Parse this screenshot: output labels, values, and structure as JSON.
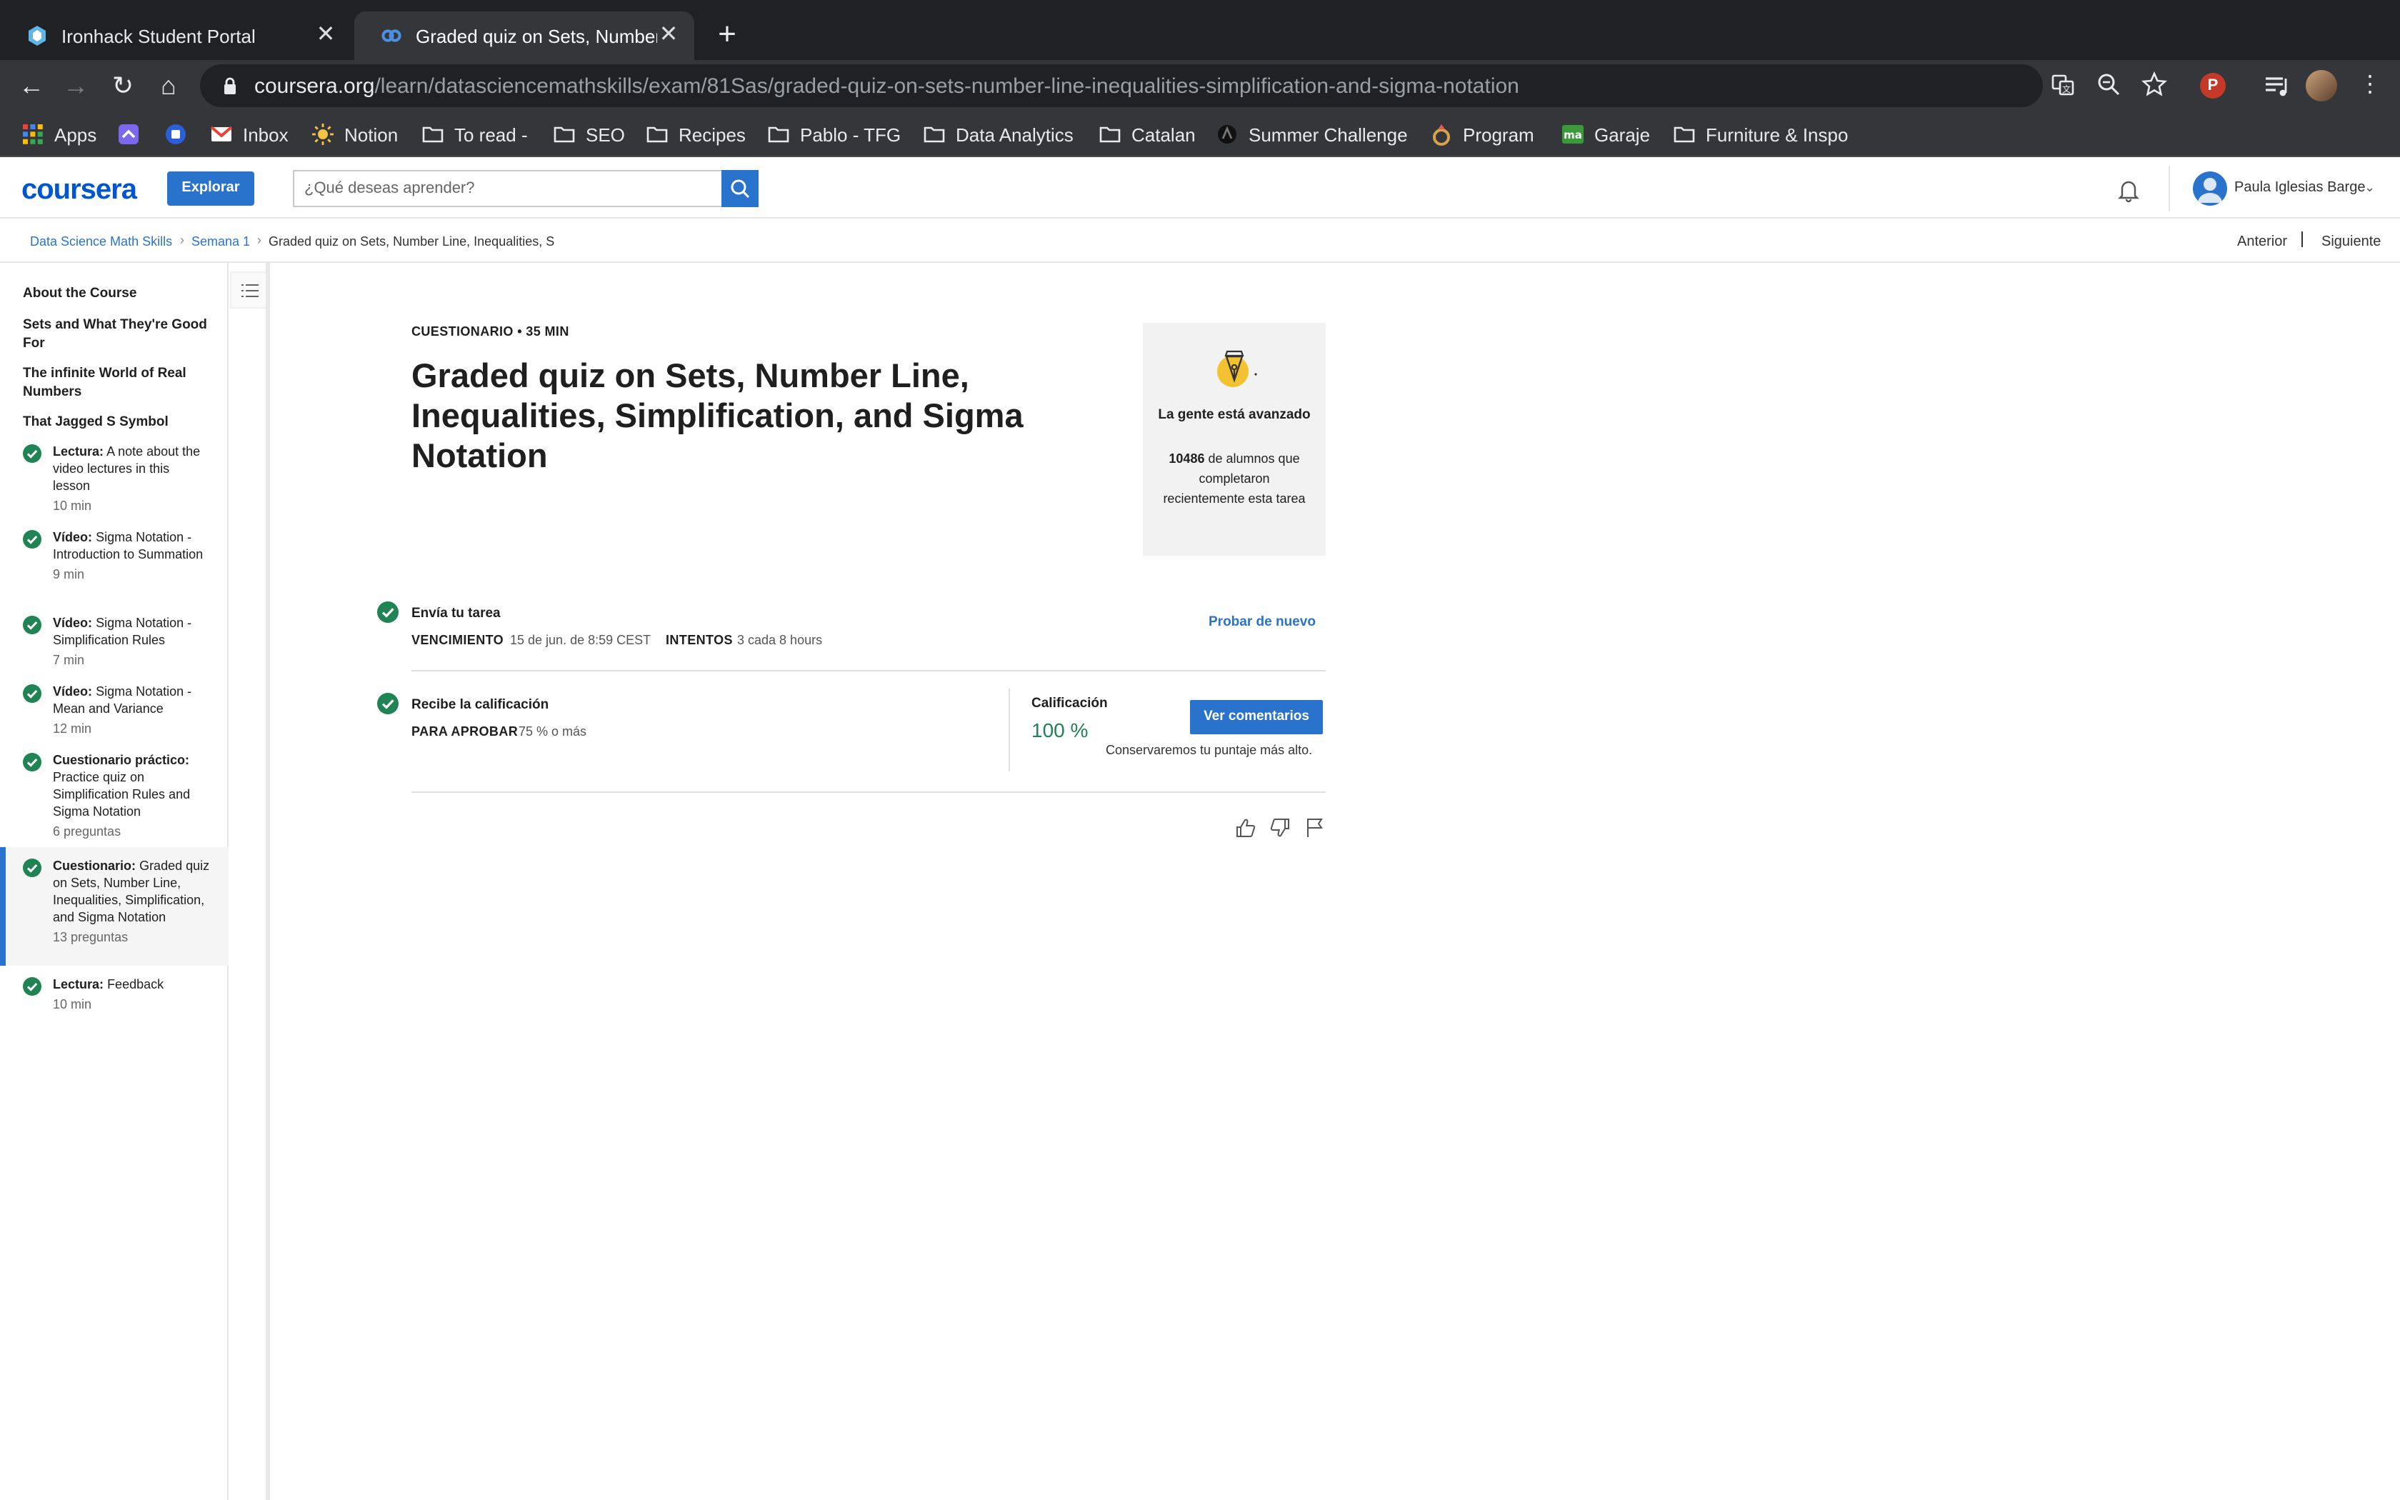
{
  "browser": {
    "tabs": [
      {
        "title": "Ironhack Student Portal",
        "active": false
      },
      {
        "title": "Graded quiz on Sets, Number L",
        "active": true
      }
    ],
    "url_host": "coursera.org",
    "url_path": "/learn/datasciencemathskills/exam/81Sas/graded-quiz-on-sets-number-line-inequalities-simplification-and-sigma-notation",
    "profile_badge": "P",
    "bookmarks": [
      {
        "label": "Apps",
        "icon": "apps-grid-icon"
      },
      {
        "label": "",
        "icon": "clickup-icon"
      },
      {
        "label": "",
        "icon": "blue-app-icon"
      },
      {
        "label": "Inbox",
        "icon": "gmail-icon"
      },
      {
        "label": "Notion",
        "icon": "sun-icon"
      },
      {
        "label": "To read -",
        "icon": "folder-icon"
      },
      {
        "label": "SEO",
        "icon": "folder-icon"
      },
      {
        "label": "Recipes",
        "icon": "folder-icon"
      },
      {
        "label": "Pablo - TFG",
        "icon": "folder-icon"
      },
      {
        "label": "Data Analytics",
        "icon": "folder-icon"
      },
      {
        "label": "Catalan",
        "icon": "folder-icon"
      },
      {
        "label": "Summer Challenge",
        "icon": "dark-site-icon"
      },
      {
        "label": "Program",
        "icon": "ring-icon"
      },
      {
        "label": "Garaje",
        "icon": "ma-icon"
      },
      {
        "label": "Furniture & Inspo",
        "icon": "folder-icon"
      }
    ]
  },
  "header": {
    "logo": "coursera",
    "explore_label": "Explorar",
    "search_placeholder": "¿Qué deseas aprender?",
    "user_name": "Paula Iglesias Barge"
  },
  "breadcrumb": {
    "items": [
      "Data Science Math Skills",
      "Semana 1",
      "Graded quiz on Sets, Number Line, Inequalities, S"
    ],
    "prev_label": "Anterior",
    "next_label": "Siguiente"
  },
  "sidebar": {
    "sections": [
      "About the Course",
      "Sets and What They're Good For",
      "The infinite World of Real Numbers",
      "That Jagged S Symbol"
    ],
    "items": [
      {
        "kind": "Lectura:",
        "title": "A note about the video lectures in this lesson",
        "meta": "10 min",
        "active": false
      },
      {
        "kind": "Vídeo:",
        "title": "Sigma Notation - Introduction to Summation",
        "meta": "9 min",
        "active": false
      },
      {
        "kind": "Vídeo:",
        "title": "Sigma Notation - Simplification Rules",
        "meta": "7 min",
        "active": false
      },
      {
        "kind": "Vídeo:",
        "title": "Sigma Notation - Mean and Variance",
        "meta": "12 min",
        "active": false
      },
      {
        "kind": "Cuestionario práctico:",
        "title": "Practice quiz on Simplification Rules and Sigma Notation",
        "meta": "6 preguntas",
        "active": false
      },
      {
        "kind": "Cuestionario:",
        "title": "Graded quiz on Sets, Number Line, Inequalities, Simplification, and Sigma Notation",
        "meta": "13 preguntas",
        "active": true
      },
      {
        "kind": "Lectura:",
        "title": "Feedback",
        "meta": "10 min",
        "active": false
      }
    ]
  },
  "main": {
    "eyebrow": "CUESTIONARIO • 35 MIN",
    "title": "Graded quiz on Sets, Number Line, Inequalities, Simplification, and Sigma Notation",
    "stats": {
      "heading": "La gente está avanzado",
      "count": "10486",
      "text": "de alumnos que completaron recientemente esta tarea"
    },
    "submit": {
      "title": "Envía tu tarea",
      "due_key": "VENCIMIENTO",
      "due_value": "15 de jun. de 8:59 CEST",
      "attempts_key": "INTENTOS",
      "attempts_value": "3 cada 8 hours",
      "retry_label": "Probar de nuevo"
    },
    "grade": {
      "title": "Recibe la calificación",
      "pass_key": "PARA APROBAR",
      "pass_value": "75 % o más",
      "label": "Calificación",
      "value": "100 %",
      "feedback_label": "Ver comentarios",
      "note": "Conservaremos tu puntaje más alto."
    }
  },
  "colors": {
    "accent": "#2a73cc",
    "success": "#1f8354",
    "chrome_dark": "#202124"
  }
}
